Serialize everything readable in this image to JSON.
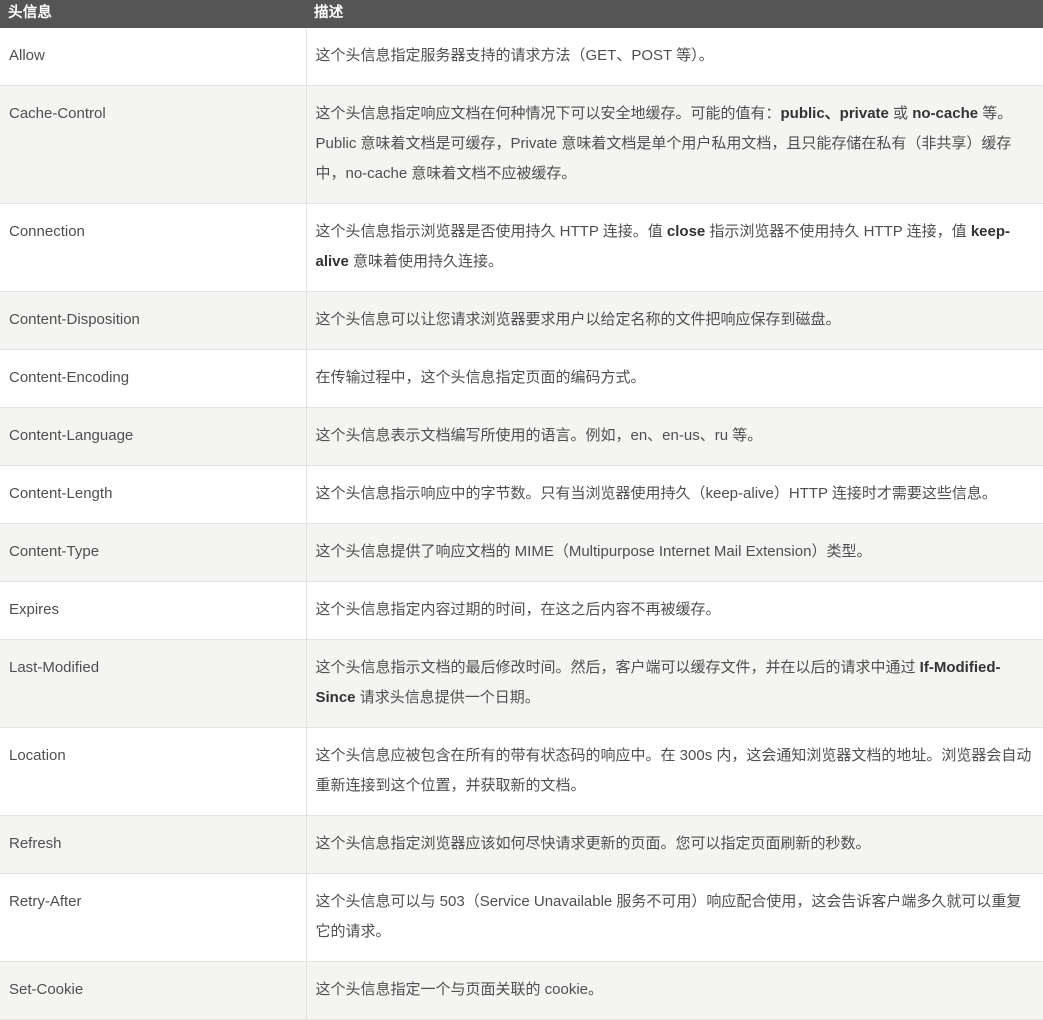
{
  "table": {
    "columns": [
      {
        "key": "name",
        "label": "头信息"
      },
      {
        "key": "desc",
        "label": "描述"
      }
    ],
    "rows": [
      {
        "name": "Allow",
        "desc_html": "这个头信息指定服务器支持的请求方法（GET、POST 等）。",
        "desc_text": "这个头信息指定服务器支持的请求方法（GET、POST 等）。"
      },
      {
        "name": "Cache-Control",
        "desc_html": "这个头信息指定响应文档在何种情况下可以安全地缓存。可能的值有：<b>public、private</b> 或 <b>no-cache</b> 等。Public 意味着文档是可缓存，Private 意味着文档是单个用户私用文档，且只能存储在私有（非共享）缓存中，no-cache 意味着文档不应被缓存。",
        "desc_text": "这个头信息指定响应文档在何种情况下可以安全地缓存。可能的值有：public、private 或 no-cache 等。Public 意味着文档是可缓存，Private 意味着文档是单个用户私用文档，且只能存储在私有（非共享）缓存中，no-cache 意味着文档不应被缓存。"
      },
      {
        "name": "Connection",
        "desc_html": "这个头信息指示浏览器是否使用持久 HTTP 连接。值 <b>close</b> 指示浏览器不使用持久 HTTP 连接，值 <b>keep-alive</b> 意味着使用持久连接。",
        "desc_text": "这个头信息指示浏览器是否使用持久 HTTP 连接。值 close 指示浏览器不使用持久 HTTP 连接，值 keep-alive 意味着使用持久连接。"
      },
      {
        "name": "Content-Disposition",
        "desc_html": "这个头信息可以让您请求浏览器要求用户以给定名称的文件把响应保存到磁盘。",
        "desc_text": "这个头信息可以让您请求浏览器要求用户以给定名称的文件把响应保存到磁盘。"
      },
      {
        "name": "Content-Encoding",
        "desc_html": "在传输过程中，这个头信息指定页面的编码方式。",
        "desc_text": "在传输过程中，这个头信息指定页面的编码方式。"
      },
      {
        "name": "Content-Language",
        "desc_html": "这个头信息表示文档编写所使用的语言。例如，en、en-us、ru 等。",
        "desc_text": "这个头信息表示文档编写所使用的语言。例如，en、en-us、ru 等。"
      },
      {
        "name": "Content-Length",
        "desc_html": "这个头信息指示响应中的字节数。只有当浏览器使用持久（keep-alive）HTTP 连接时才需要这些信息。",
        "desc_text": "这个头信息指示响应中的字节数。只有当浏览器使用持久（keep-alive）HTTP 连接时才需要这些信息。"
      },
      {
        "name": "Content-Type",
        "desc_html": "这个头信息提供了响应文档的 MIME（Multipurpose Internet Mail Extension）类型。",
        "desc_text": "这个头信息提供了响应文档的 MIME（Multipurpose Internet Mail Extension）类型。"
      },
      {
        "name": "Expires",
        "desc_html": "这个头信息指定内容过期的时间，在这之后内容不再被缓存。",
        "desc_text": "这个头信息指定内容过期的时间，在这之后内容不再被缓存。"
      },
      {
        "name": "Last-Modified",
        "desc_html": "这个头信息指示文档的最后修改时间。然后，客户端可以缓存文件，并在以后的请求中通过 <b>If-Modified-Since</b> 请求头信息提供一个日期。",
        "desc_text": "这个头信息指示文档的最后修改时间。然后，客户端可以缓存文件，并在以后的请求中通过 If-Modified-Since 请求头信息提供一个日期。"
      },
      {
        "name": "Location",
        "desc_html": "这个头信息应被包含在所有的带有状态码的响应中。在 300s 内，这会通知浏览器文档的地址。浏览器会自动重新连接到这个位置，并获取新的文档。",
        "desc_text": "这个头信息应被包含在所有的带有状态码的响应中。在 300s 内，这会通知浏览器文档的地址。浏览器会自动重新连接到这个位置，并获取新的文档。"
      },
      {
        "name": "Refresh",
        "desc_html": "这个头信息指定浏览器应该如何尽快请求更新的页面。您可以指定页面刷新的秒数。",
        "desc_text": "这个头信息指定浏览器应该如何尽快请求更新的页面。您可以指定页面刷新的秒数。"
      },
      {
        "name": "Retry-After",
        "desc_html": "这个头信息可以与 503（Service Unavailable 服务不可用）响应配合使用，这会告诉客户端多久就可以重复它的请求。",
        "desc_text": "这个头信息可以与 503（Service Unavailable 服务不可用）响应配合使用，这会告诉客户端多久就可以重复它的请求。"
      },
      {
        "name": "Set-Cookie",
        "desc_html": "这个头信息指定一个与页面关联的 cookie。",
        "desc_text": "这个头信息指定一个与页面关联的 cookie。"
      }
    ]
  },
  "colors": {
    "header_background": "#555555",
    "header_text": "#ffffff",
    "row_odd_background": "#ffffff",
    "row_even_background": "#f4f4f2",
    "border": "#e3e3e1",
    "body_text": "#4f4f4f"
  }
}
